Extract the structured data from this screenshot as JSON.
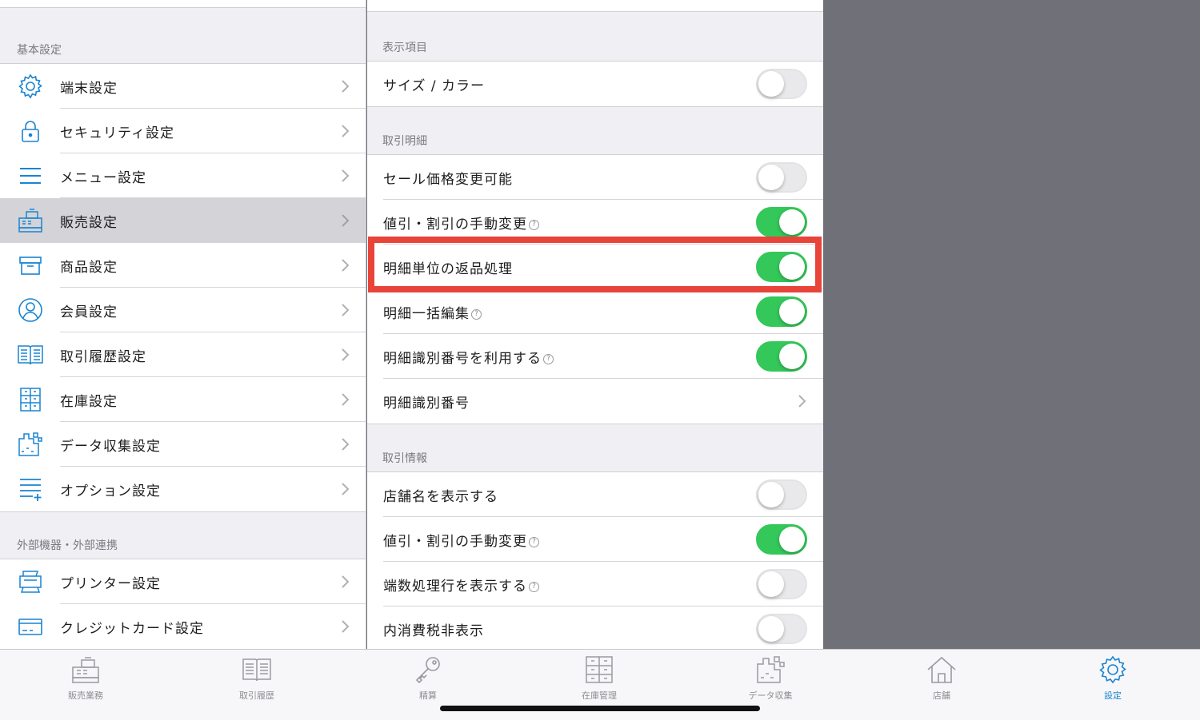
{
  "sidebar": {
    "section1": "基本設定",
    "section2": "外部機器・外部連携",
    "items": [
      {
        "label": "端末設定",
        "icon": "gear-icon"
      },
      {
        "label": "セキュリティ設定",
        "icon": "lock-icon"
      },
      {
        "label": "メニュー設定",
        "icon": "menu-icon"
      },
      {
        "label": "販売設定",
        "icon": "register-icon",
        "selected": true
      },
      {
        "label": "商品設定",
        "icon": "box-icon"
      },
      {
        "label": "会員設定",
        "icon": "user-icon"
      },
      {
        "label": "取引履歴設定",
        "icon": "book-icon"
      },
      {
        "label": "在庫設定",
        "icon": "cabinet-icon"
      },
      {
        "label": "データ収集設定",
        "icon": "data-icon"
      },
      {
        "label": "オプション設定",
        "icon": "list-plus-icon"
      }
    ],
    "items2": [
      {
        "label": "プリンター設定",
        "icon": "printer-icon"
      },
      {
        "label": "クレジットカード設定",
        "icon": "card-icon"
      }
    ]
  },
  "detail": {
    "sections": [
      {
        "header": "表示項目",
        "rows": [
          {
            "label": "サイズ / カラー",
            "toggle": false,
            "help": false
          }
        ]
      },
      {
        "header": "取引明細",
        "rows": [
          {
            "label": "セール価格変更可能",
            "toggle": false,
            "help": false
          },
          {
            "label": "値引・割引の手動変更",
            "toggle": true,
            "help": true
          },
          {
            "label": "明細単位の返品処理",
            "toggle": true,
            "help": false
          },
          {
            "label": "明細一括編集",
            "toggle": true,
            "help": true
          },
          {
            "label": "明細識別番号を利用する",
            "toggle": true,
            "help": true
          },
          {
            "label": "明細識別番号",
            "chevron": true,
            "help": false
          }
        ]
      },
      {
        "header": "取引情報",
        "rows": [
          {
            "label": "店舗名を表示する",
            "toggle": false,
            "help": false
          },
          {
            "label": "値引・割引の手動変更",
            "toggle": true,
            "help": true
          },
          {
            "label": "端数処理行を表示する",
            "toggle": false,
            "help": true
          },
          {
            "label": "内消費税非表示",
            "toggle": false,
            "help": false
          }
        ]
      }
    ],
    "help_glyph": "?"
  },
  "tabbar": {
    "tabs": [
      {
        "label": "販売業務",
        "icon": "register-icon"
      },
      {
        "label": "取引履歴",
        "icon": "book-icon"
      },
      {
        "label": "精算",
        "icon": "key-icon"
      },
      {
        "label": "在庫管理",
        "icon": "cabinet-icon"
      },
      {
        "label": "データ収集",
        "icon": "data-icon"
      },
      {
        "label": "店舗",
        "icon": "home-icon"
      },
      {
        "label": "設定",
        "icon": "gear-icon",
        "active": true
      }
    ]
  },
  "colors": {
    "accent": "#1a84d0",
    "toggle_on": "#34c759",
    "highlight": "#e8443a",
    "selected_row": "#d4d4d8"
  }
}
